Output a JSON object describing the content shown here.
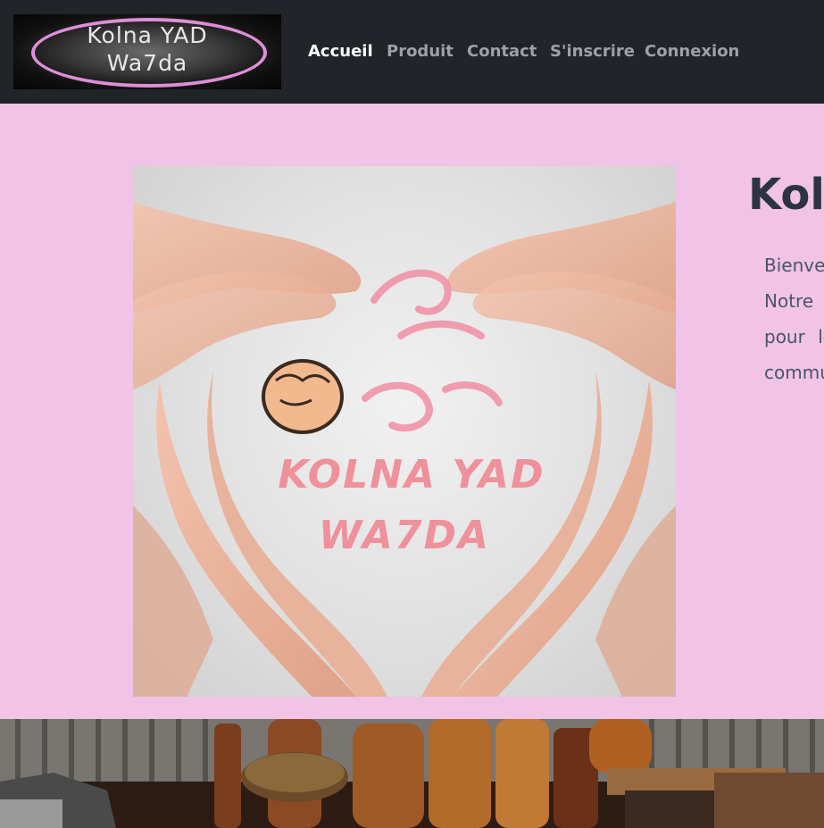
{
  "logo": {
    "line1": "Kolna YAD",
    "line2": "Wa7da"
  },
  "nav": {
    "items": [
      {
        "label": "Accueil",
        "active": true
      },
      {
        "label": "Produit",
        "active": false
      },
      {
        "label": "Contact",
        "active": false
      },
      {
        "label": "S'inscrire",
        "active": false
      },
      {
        "label": "Connexion",
        "active": false
      }
    ]
  },
  "hero": {
    "image": {
      "line1": "KOLNA YAD",
      "line2": "WA7DA"
    },
    "title": "Koln",
    "paragraph_lines": [
      "Bienven",
      "Notre r",
      "pour  le",
      "commu"
    ]
  },
  "colors": {
    "page_bg": "#f0c3e7",
    "navbar_bg": "#212529",
    "nav_active": "#ffffff",
    "nav_inactive": "#9ea1a6",
    "heading": "#2c3444",
    "logo_ring": "#dd8fd8",
    "image_text": "#ef8a94"
  }
}
